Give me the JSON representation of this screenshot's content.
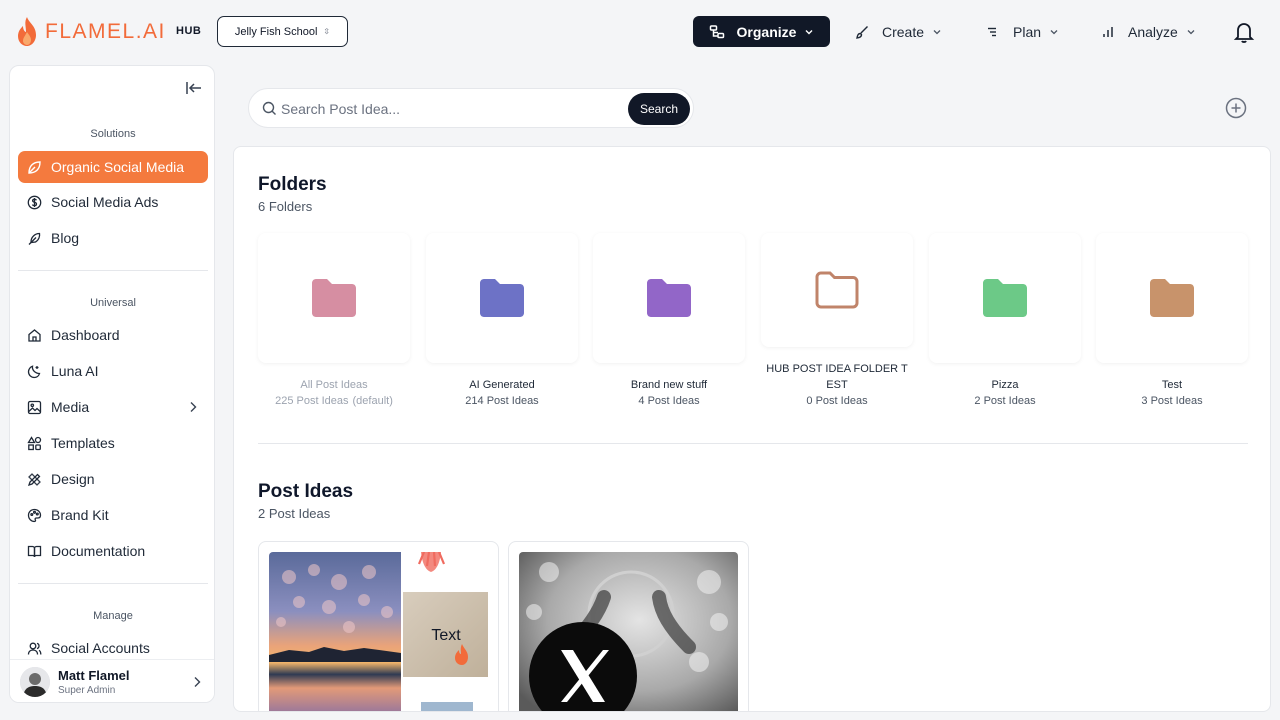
{
  "brand": {
    "name": "FLAMEL.AI",
    "tag": "HUB",
    "accent": "#f26b3a"
  },
  "workspace": {
    "name": "Jelly Fish School"
  },
  "topnav": {
    "organize": "Organize",
    "create": "Create",
    "plan": "Plan",
    "analyze": "Analyze"
  },
  "sidebar": {
    "sections": {
      "solutions": "Solutions",
      "universal": "Universal",
      "manage": "Manage"
    },
    "solutions": [
      {
        "label": "Organic Social Media",
        "icon": "leaf-icon",
        "active": true
      },
      {
        "label": "Social Media Ads",
        "icon": "dollar-circle-icon"
      },
      {
        "label": "Blog",
        "icon": "feather-icon"
      }
    ],
    "universal": [
      {
        "label": "Dashboard",
        "icon": "home-icon"
      },
      {
        "label": "Luna AI",
        "icon": "moon-icon"
      },
      {
        "label": "Media",
        "icon": "image-icon"
      },
      {
        "label": "Templates",
        "icon": "shapes-icon"
      },
      {
        "label": "Design",
        "icon": "pen-ruler-icon"
      },
      {
        "label": "Brand Kit",
        "icon": "palette-icon"
      },
      {
        "label": "Documentation",
        "icon": "book-icon"
      }
    ],
    "manage": [
      {
        "label": "Social Accounts",
        "icon": "users-icon"
      }
    ]
  },
  "user": {
    "name": "Matt Flamel",
    "role": "Super Admin"
  },
  "search": {
    "placeholder": "Search Post Idea...",
    "button": "Search"
  },
  "folders_section": {
    "title": "Folders",
    "count": "6 Folders",
    "items": [
      {
        "name": "All Post Ideas",
        "count": "225 Post Ideas",
        "tag": "(default)",
        "color": "#d68ea2"
      },
      {
        "name": "AI Generated",
        "count": "214 Post Ideas",
        "color": "#6d72c6"
      },
      {
        "name": "Brand new stuff",
        "count": "4 Post Ideas",
        "color": "#9266c8"
      },
      {
        "name": "HUB POST IDEA FOLDER T",
        "name2": "EST",
        "count": "0 Post Ideas",
        "color": "#c0846a"
      },
      {
        "name": "Pizza",
        "count": "2 Post Ideas",
        "color": "#6cc987"
      },
      {
        "name": "Test",
        "count": "3 Post Ideas",
        "color": "#c8936b"
      }
    ]
  },
  "posts_section": {
    "title": "Post Ideas",
    "count": "2 Post Ideas",
    "card1_text": "Text"
  }
}
